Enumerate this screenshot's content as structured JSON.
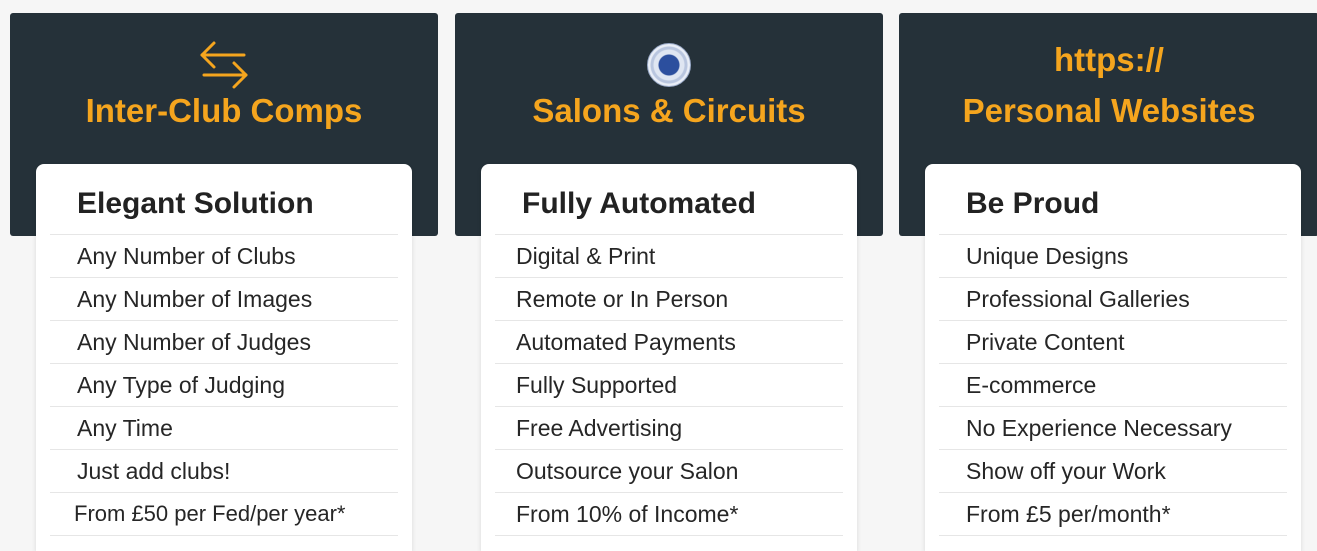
{
  "columns": [
    {
      "header_title": "Inter-Club Comps",
      "icon": "swap-arrows-icon",
      "card_title": "Elegant Solution",
      "items": [
        "Any Number of Clubs",
        "Any Number of Images",
        "Any Number of Judges",
        "Any Type of Judging",
        "Any Time",
        "Just add clubs!",
        "From £50 per Fed/per year*"
      ]
    },
    {
      "header_title": "Salons & Circuits",
      "icon": "federation-seal-icon",
      "card_title": "Fully Automated",
      "items": [
        "Digital & Print",
        "Remote or In Person",
        "Automated Payments",
        "Fully Supported",
        "Free Advertising",
        "Outsource your Salon",
        "From 10% of Income*"
      ]
    },
    {
      "header_line1": "https://",
      "header_title": "Personal Websites",
      "card_title": "Be Proud",
      "items": [
        "Unique Designs",
        "Professional Galleries",
        "Private Content",
        "E-commerce",
        "No Experience Necessary",
        "Show off your Work",
        "From £5 per/month*"
      ]
    }
  ],
  "colors": {
    "header_bg": "#253139",
    "accent": "#f5a51e",
    "card_bg": "#ffffff",
    "text": "#262626"
  }
}
